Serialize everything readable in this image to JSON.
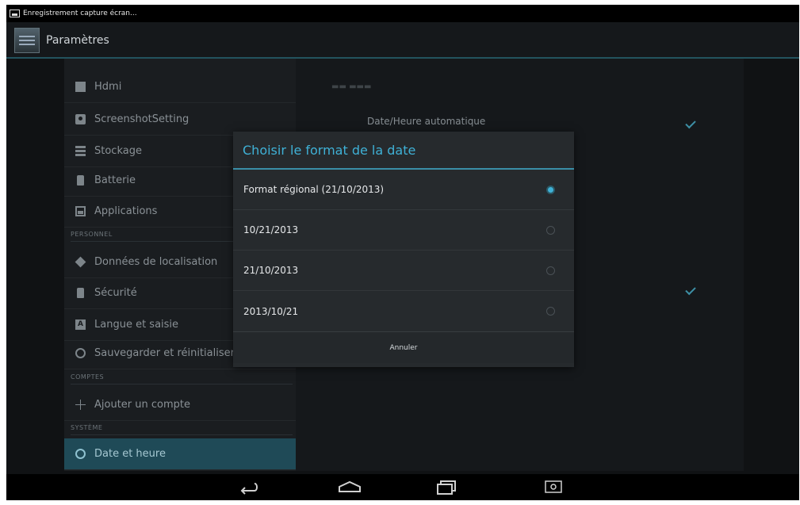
{
  "status_bar": {
    "notification": "Enregistrement capture écran..."
  },
  "action_bar": {
    "title": "Paramètres"
  },
  "settings_list": {
    "items": [
      {
        "label": "Hdmi",
        "icon": "hdmi-icon"
      },
      {
        "label": "ScreenshotSetting",
        "icon": "camera-icon"
      },
      {
        "label": "Stockage",
        "icon": "storage-icon"
      },
      {
        "label": "Batterie",
        "icon": "battery-icon"
      },
      {
        "label": "Applications",
        "icon": "apps-icon"
      }
    ],
    "category_personnel": "PERSONNEL",
    "personal_items": [
      {
        "label": "Données de localisation",
        "icon": "location-icon"
      },
      {
        "label": "Sécurité",
        "icon": "lock-icon"
      },
      {
        "label": "Langue et saisie",
        "icon": "language-icon"
      },
      {
        "label": "Sauvegarder et réinitialiser",
        "icon": "restore-icon"
      }
    ],
    "category_comptes": "COMPTES",
    "add_account": "Ajouter un compte",
    "category_systeme": "SYSTÈME",
    "date_time": "Date et heure",
    "language_icon_glyph": "A"
  },
  "date_settings": {
    "auto_label": "Date/Heure automatique",
    "auto_checked": true
  },
  "dialog": {
    "title": "Choisir le format de la date",
    "options": [
      {
        "label": "Format régional (21/10/2013)",
        "selected": true
      },
      {
        "label": "10/21/2013",
        "selected": false
      },
      {
        "label": "21/10/2013",
        "selected": false
      },
      {
        "label": "2013/10/21",
        "selected": false
      }
    ],
    "cancel": "Annuler"
  },
  "colors": {
    "accent": "#3fb1d6",
    "selected_row": "#1f4a57"
  }
}
